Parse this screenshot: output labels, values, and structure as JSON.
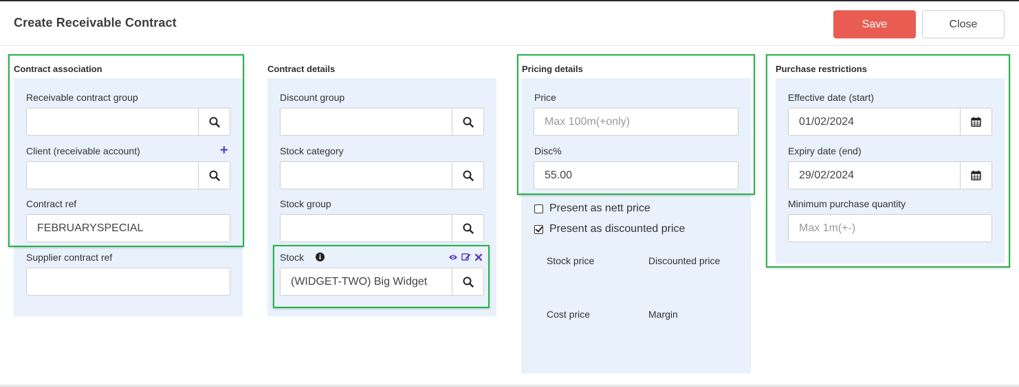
{
  "header": {
    "title": "Create Receivable Contract",
    "save_label": "Save",
    "close_label": "Close"
  },
  "association": {
    "title": "Contract association",
    "group_label": "Receivable contract group",
    "group_value": "",
    "client_label": "Client (receivable account)",
    "client_value": "",
    "ref_label": "Contract ref",
    "ref_value": "FEBRUARYSPECIAL",
    "supplier_ref_label": "Supplier contract ref",
    "supplier_ref_value": ""
  },
  "details": {
    "title": "Contract details",
    "discount_group_label": "Discount group",
    "stock_category_label": "Stock category",
    "stock_group_label": "Stock group",
    "stock_label": "Stock",
    "stock_value": "(WIDGET-TWO) Big Widget"
  },
  "pricing": {
    "title": "Pricing details",
    "price_label": "Price",
    "price_placeholder": "Max 100m(+only)",
    "disc_label": "Disc%",
    "disc_value": "55.00",
    "nett_label": "Present as nett price",
    "nett_checked": false,
    "discounted_label": "Present as discounted price",
    "discounted_checked": true,
    "stock_price_label": "Stock price",
    "discounted_price_label": "Discounted price",
    "cost_price_label": "Cost price",
    "margin_label": "Margin"
  },
  "restrictions": {
    "title": "Purchase restrictions",
    "start_label": "Effective date (start)",
    "start_value": "01/02/2024",
    "end_label": "Expiry date (end)",
    "end_value": "29/02/2024",
    "min_qty_label": "Minimum purchase quantity",
    "min_qty_placeholder": "Max 1m(+-)"
  },
  "colors": {
    "accent": "#e85c52",
    "panel": "#e8f1fc",
    "highlight": "#27b24a",
    "icon_purple": "#5b3cc4"
  }
}
